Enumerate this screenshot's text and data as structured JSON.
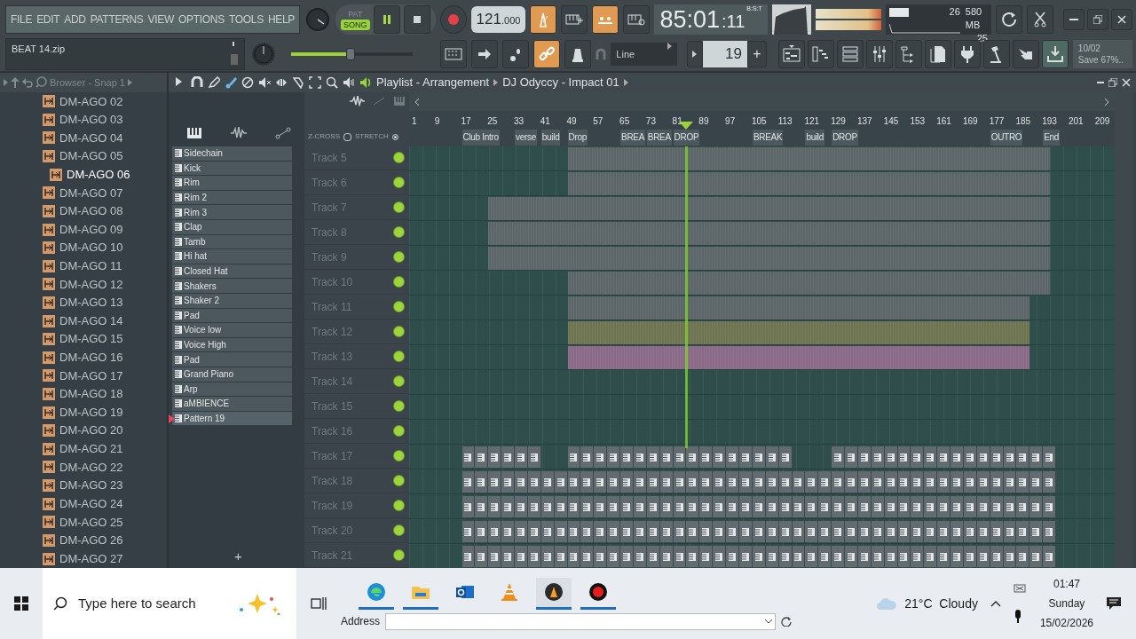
{
  "menu": [
    "FILE",
    "EDIT",
    "ADD",
    "PATTERNS",
    "VIEW",
    "OPTIONS",
    "TOOLS",
    "HELP"
  ],
  "project_file": "BEAT 14.zip",
  "transport": {
    "modes": [
      {
        "label": "PAT",
        "selected": false
      },
      {
        "label": "SONG",
        "selected": true
      }
    ],
    "playing": true,
    "recording": false,
    "tempo": "121",
    "tempo_fraction": ".000"
  },
  "master_volume": {
    "level": 0.49
  },
  "clock": {
    "time": "85:01",
    "ticks": ":11",
    "format": "B:S:T"
  },
  "performance": {
    "cpu": "26",
    "memory": "580 MB",
    "polyphony": "25"
  },
  "snap": "Line",
  "pattern_number": "19",
  "pattern_add": "+",
  "hint": {
    "line_1": "10/02",
    "line_2": "Save 67%.."
  },
  "browser": {
    "title": "Browser - Snap 1",
    "items": [
      {
        "label": "DM-AGO 02",
        "selected": false
      },
      {
        "label": "DM-AGO 03",
        "selected": false
      },
      {
        "label": "DM-AGO 04",
        "selected": false
      },
      {
        "label": "DM-AGO 05",
        "selected": false
      },
      {
        "label": "DM-AGO 06",
        "selected": true
      },
      {
        "label": "DM-AGO 07",
        "selected": false
      },
      {
        "label": "DM-AGO 08",
        "selected": false
      },
      {
        "label": "DM-AGO 09",
        "selected": false
      },
      {
        "label": "DM-AGO 10",
        "selected": false
      },
      {
        "label": "DM-AGO 11",
        "selected": false
      },
      {
        "label": "DM-AGO 12",
        "selected": false
      },
      {
        "label": "DM-AGO 13",
        "selected": false
      },
      {
        "label": "DM-AGO 14",
        "selected": false
      },
      {
        "label": "DM-AGO 15",
        "selected": false
      },
      {
        "label": "DM-AGO 16",
        "selected": false
      },
      {
        "label": "DM-AGO 17",
        "selected": false
      },
      {
        "label": "DM-AGO 18",
        "selected": false
      },
      {
        "label": "DM-AGO 19",
        "selected": false
      },
      {
        "label": "DM-AGO 20",
        "selected": false
      },
      {
        "label": "DM-AGO 21",
        "selected": false
      },
      {
        "label": "DM-AGO 22",
        "selected": false
      },
      {
        "label": "DM-AGO 23",
        "selected": false
      },
      {
        "label": "DM-AGO 24",
        "selected": false
      },
      {
        "label": "DM-AGO 25",
        "selected": false
      },
      {
        "label": "DM-AGO 26",
        "selected": false
      },
      {
        "label": "DM-AGO 27",
        "selected": false
      }
    ]
  },
  "playlist": {
    "title": "Playlist - Arrangement",
    "pattern": "DJ Odyccy - Impact 01",
    "picker": [
      {
        "label": "Sidechain",
        "selected": false
      },
      {
        "label": "Kick",
        "selected": false
      },
      {
        "label": "Rim",
        "selected": false
      },
      {
        "label": "Rim 2",
        "selected": false
      },
      {
        "label": "Rim 3",
        "selected": false
      },
      {
        "label": "Clap",
        "selected": false
      },
      {
        "label": "Tamb",
        "selected": false
      },
      {
        "label": "Hi hat",
        "selected": false
      },
      {
        "label": "Closed Hat",
        "selected": false
      },
      {
        "label": "Shakers",
        "selected": false
      },
      {
        "label": "Shaker 2",
        "selected": false
      },
      {
        "label": "Pad",
        "selected": false
      },
      {
        "label": "Voice low",
        "selected": false
      },
      {
        "label": "Voice  High",
        "selected": false
      },
      {
        "label": "Pad",
        "selected": false
      },
      {
        "label": "Grand Piano",
        "selected": false
      },
      {
        "label": "Arp",
        "selected": false
      },
      {
        "label": "aMBIENCE",
        "selected": false
      },
      {
        "label": "Pattern 19",
        "selected": true
      }
    ],
    "picker_add": "+",
    "z_cross": {
      "label": "Z-CROSS",
      "on": false
    },
    "stretch": {
      "label": "STRETCH",
      "on": true
    },
    "ruler": [
      "1",
      "9",
      "17",
      "25",
      "33",
      "41",
      "49",
      "57",
      "65",
      "73",
      "81",
      "89",
      "97",
      "105",
      "113",
      "121",
      "129",
      "137",
      "145",
      "153",
      "161",
      "169",
      "177",
      "185",
      "193",
      "201",
      "209"
    ],
    "markers": [
      {
        "label": "Club Intro"
      },
      {
        "label": "verse"
      },
      {
        "label": "build"
      },
      {
        "label": "Drop"
      },
      {
        "label": "BREA"
      },
      {
        "label": "BREA"
      },
      {
        "label": "DROP"
      },
      {
        "label": "BREAK"
      },
      {
        "label": "build"
      },
      {
        "label": "DROP"
      },
      {
        "label": "OUTRO"
      },
      {
        "label": "End"
      }
    ],
    "tracks": [
      {
        "name": "Track 5",
        "enabled": true
      },
      {
        "name": "Track 6",
        "enabled": true
      },
      {
        "name": "Track 7",
        "enabled": true
      },
      {
        "name": "Track 8",
        "enabled": true
      },
      {
        "name": "Track 9",
        "enabled": true
      },
      {
        "name": "Track 10",
        "enabled": true
      },
      {
        "name": "Track 11",
        "enabled": true
      },
      {
        "name": "Track 12",
        "enabled": true
      },
      {
        "name": "Track 13",
        "enabled": true
      },
      {
        "name": "Track 14",
        "enabled": true
      },
      {
        "name": "Track 15",
        "enabled": true
      },
      {
        "name": "Track 16",
        "enabled": true
      },
      {
        "name": "Track 17",
        "enabled": true
      },
      {
        "name": "Track 18",
        "enabled": true
      },
      {
        "name": "Track 19",
        "enabled": true
      },
      {
        "name": "Track 20",
        "enabled": true
      },
      {
        "name": "Track 21",
        "enabled": true
      }
    ]
  },
  "taskbar": {
    "search_placeholder": "Type here to search",
    "apps": [
      {
        "kind": "browser",
        "running": true,
        "selected": false
      },
      {
        "kind": "folder",
        "running": true,
        "selected": false
      },
      {
        "kind": "mail",
        "running": false,
        "selected": false
      },
      {
        "kind": "cone",
        "running": false,
        "selected": false
      },
      {
        "kind": "daw",
        "running": true,
        "selected": true
      },
      {
        "kind": "record",
        "running": true,
        "selected": false
      }
    ],
    "address_label": "Address",
    "weather": "21°C  Cloudy",
    "time": "01:47",
    "day": "Sunday",
    "date": "15/02/2026"
  }
}
